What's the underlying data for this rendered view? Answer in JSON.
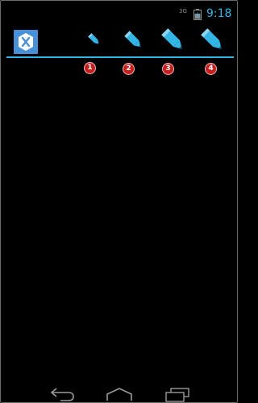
{
  "status_bar": {
    "signal_label": "3G",
    "time": "9:18",
    "battery_icon": "battery-charging-icon",
    "colors": {
      "accent": "#33b5e5",
      "muted": "#8d8d8d"
    }
  },
  "action_bar": {
    "logo_icon": "xamarin-logo-icon",
    "logo_color": "#4a90d9",
    "divider_color": "#33b5e5",
    "pencils": [
      {
        "icon": "pencil-icon",
        "badge": "1"
      },
      {
        "icon": "pencil-icon",
        "badge": "2"
      },
      {
        "icon": "pencil-icon",
        "badge": "3"
      },
      {
        "icon": "pencil-icon",
        "badge": "4"
      }
    ],
    "badge_color": "#c81e1e"
  },
  "nav_bar": {
    "back_icon": "back-icon",
    "home_icon": "home-icon",
    "recents_icon": "recent-apps-icon"
  }
}
